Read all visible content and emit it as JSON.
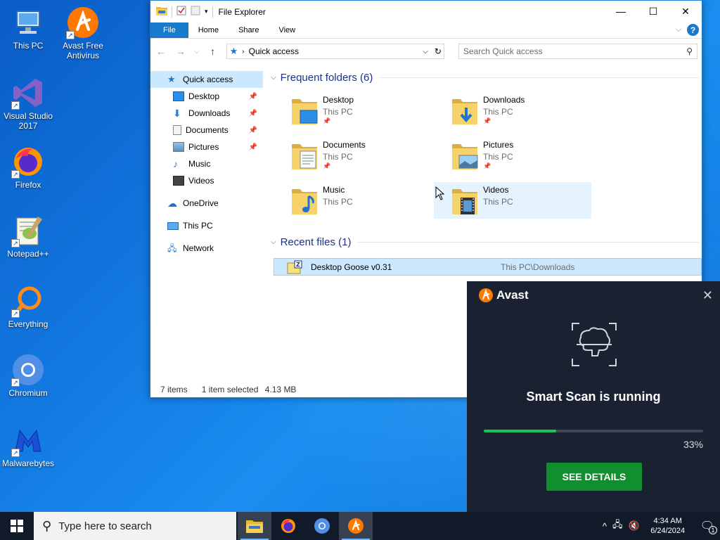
{
  "desktop": {
    "icons": [
      {
        "label": "This PC"
      },
      {
        "label": "Avast Free\nAntivirus"
      },
      {
        "label": "Visual Studio\n2017"
      },
      {
        "label": "Firefox"
      },
      {
        "label": "Notepad++"
      },
      {
        "label": "Everything"
      },
      {
        "label": "Chromium"
      },
      {
        "label": "Malwarebytes"
      }
    ]
  },
  "explorer": {
    "title": "File Explorer",
    "tabs": [
      "File",
      "Home",
      "Share",
      "View"
    ],
    "address": "Quick access",
    "search_placeholder": "Search Quick access",
    "nav": {
      "quick_access": "Quick access",
      "items": [
        {
          "label": "Desktop",
          "pinned": true
        },
        {
          "label": "Downloads",
          "pinned": true
        },
        {
          "label": "Documents",
          "pinned": true
        },
        {
          "label": "Pictures",
          "pinned": true
        },
        {
          "label": "Music",
          "pinned": false
        },
        {
          "label": "Videos",
          "pinned": false
        }
      ],
      "onedrive": "OneDrive",
      "thispc": "This PC",
      "network": "Network"
    },
    "frequent": {
      "header": "Frequent folders (6)",
      "folders": [
        {
          "name": "Desktop",
          "location": "This PC",
          "pinned": true
        },
        {
          "name": "Downloads",
          "location": "This PC",
          "pinned": true
        },
        {
          "name": "Documents",
          "location": "This PC",
          "pinned": true
        },
        {
          "name": "Pictures",
          "location": "This PC",
          "pinned": true
        },
        {
          "name": "Music",
          "location": "This PC",
          "pinned": false
        },
        {
          "name": "Videos",
          "location": "This PC",
          "pinned": false
        }
      ]
    },
    "recent": {
      "header": "Recent files (1)",
      "files": [
        {
          "name": "Desktop Goose v0.31",
          "path": "This PC\\Downloads"
        }
      ]
    },
    "status": {
      "items": "7 items",
      "selected": "1 item selected",
      "size": "4.13 MB"
    }
  },
  "avast": {
    "brand": "Avast",
    "title": "Smart Scan is running",
    "progress_percent": 33,
    "progress_label": "33%",
    "button": "SEE DETAILS",
    "accent": "#ff7800",
    "progress_color": "#19c35a",
    "button_color": "#0f8f2e"
  },
  "taskbar": {
    "search_placeholder": "Type here to search",
    "time": "4:34 AM",
    "date": "6/24/2024",
    "notification_count": "1"
  }
}
